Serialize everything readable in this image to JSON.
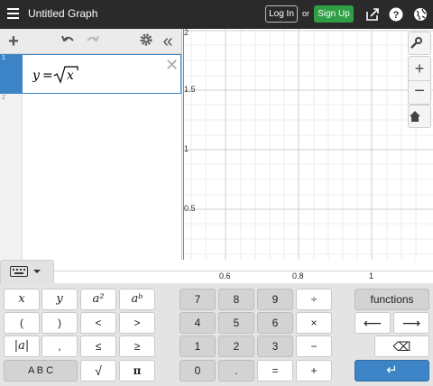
{
  "header": {
    "title": "Untitled Graph",
    "login_label": "Log In",
    "or_label": "or",
    "signup_label": "Sign Up",
    "icons": [
      "menu-icon",
      "share-icon",
      "help-icon",
      "globe-icon"
    ],
    "accent": "#2f9e44"
  },
  "expressions": {
    "items": [
      {
        "index": "1",
        "latex_display": "y = √x",
        "color": "#3c84c6"
      },
      {
        "index": "2",
        "latex_display": ""
      }
    ]
  },
  "graph": {
    "x_ticks": [
      "0.6",
      "0.8",
      "1"
    ],
    "y_ticks": [
      "2",
      "1.5",
      "1",
      "0.5"
    ]
  },
  "keypad": {
    "left": [
      "x",
      "y",
      "a²",
      "aᵇ",
      "(",
      ")",
      "<",
      ">",
      "|a|",
      ",",
      "≤",
      "≥",
      "A B C",
      "√",
      "π"
    ],
    "middle": [
      "7",
      "8",
      "9",
      "÷",
      "4",
      "5",
      "6",
      "×",
      "1",
      "2",
      "3",
      "−",
      "0",
      ".",
      "=",
      "+"
    ],
    "right": {
      "functions": "functions",
      "left_arrow": "⟵",
      "right_arrow": "⟶",
      "backspace": "⌫",
      "enter": "↵"
    }
  }
}
